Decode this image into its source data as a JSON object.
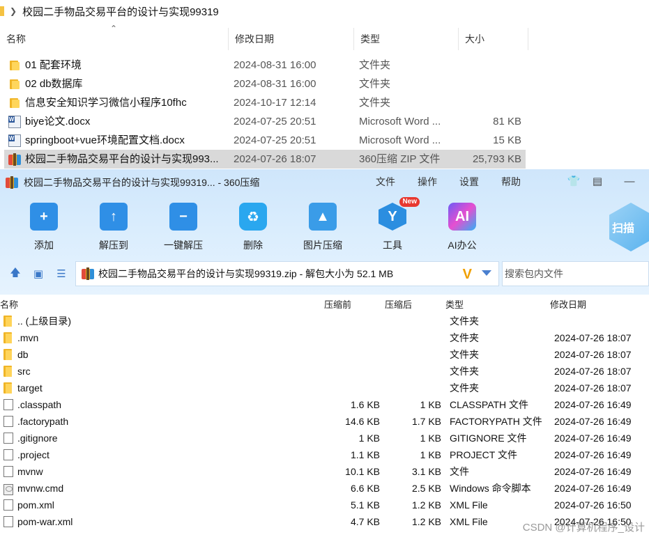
{
  "explorer": {
    "path_title": "校园二手物品交易平台的设计与实现99319",
    "columns": {
      "name": "名称",
      "modified": "修改日期",
      "type": "类型",
      "size": "大小"
    },
    "rows": [
      {
        "name": "01 配套环境",
        "date": "2024-08-31 16:00",
        "type": "文件夹",
        "size": "",
        "icon": "folder-icon"
      },
      {
        "name": "02 db数据库",
        "date": "2024-08-31 16:00",
        "type": "文件夹",
        "size": "",
        "icon": "folder-icon"
      },
      {
        "name": "信息安全知识学习微信小程序10fhc",
        "date": "2024-10-17 12:14",
        "type": "文件夹",
        "size": "",
        "icon": "folder-icon"
      },
      {
        "name": "biye论文.docx",
        "date": "2024-07-25 20:51",
        "type": "Microsoft Word ...",
        "size": "81 KB",
        "icon": "word-doc-icon"
      },
      {
        "name": "springboot+vue环境配置文档.docx",
        "date": "2024-07-25 20:51",
        "type": "Microsoft Word ...",
        "size": "15 KB",
        "icon": "word-doc-icon"
      },
      {
        "name": "校园二手物品交易平台的设计与实现993...",
        "date": "2024-07-26 18:07",
        "type": "360压缩 ZIP 文件",
        "size": "25,793 KB",
        "icon": "zip-archive-icon"
      }
    ]
  },
  "zip": {
    "title": "校园二手物品交易平台的设计与实现99319... - 360压缩",
    "menu": [
      "文件",
      "操作",
      "设置",
      "帮助"
    ],
    "toolbar": [
      {
        "label": "添加",
        "icon": "add-icon"
      },
      {
        "label": "解压到",
        "icon": "extract-to-icon"
      },
      {
        "label": "一键解压",
        "icon": "one-click-extract-icon"
      },
      {
        "label": "删除",
        "icon": "delete-icon"
      },
      {
        "label": "图片压缩",
        "icon": "image-compress-icon"
      },
      {
        "label": "工具",
        "icon": "tools-icon",
        "badge": "New"
      },
      {
        "label": "AI办公",
        "icon": "ai-office-icon",
        "glyph": "AI"
      }
    ],
    "scan_label": "扫描",
    "address": "校园二手物品交易平台的设计与实现99319.zip - 解包大小为 52.1 MB",
    "search_placeholder": "搜索包内文件",
    "columns": {
      "name": "名称",
      "packed_before": "压缩前",
      "packed_after": "压缩后",
      "type": "类型",
      "date": "修改日期"
    },
    "rows": [
      {
        "name": ".. (上级目录)",
        "before": "",
        "after": "",
        "type": "文件夹",
        "date": "",
        "kind": "folder"
      },
      {
        "name": ".mvn",
        "before": "",
        "after": "",
        "type": "文件夹",
        "date": "2024-07-26 18:07",
        "kind": "folder"
      },
      {
        "name": "db",
        "before": "",
        "after": "",
        "type": "文件夹",
        "date": "2024-07-26 18:07",
        "kind": "folder"
      },
      {
        "name": "src",
        "before": "",
        "after": "",
        "type": "文件夹",
        "date": "2024-07-26 18:07",
        "kind": "folder"
      },
      {
        "name": "target",
        "before": "",
        "after": "",
        "type": "文件夹",
        "date": "2024-07-26 18:07",
        "kind": "folder"
      },
      {
        "name": ".classpath",
        "before": "1.6 KB",
        "after": "1 KB",
        "type": "CLASSPATH 文件",
        "date": "2024-07-26 16:49",
        "kind": "file"
      },
      {
        "name": ".factorypath",
        "before": "14.6 KB",
        "after": "1.7 KB",
        "type": "FACTORYPATH 文件",
        "date": "2024-07-26 16:49",
        "kind": "file"
      },
      {
        "name": ".gitignore",
        "before": "1 KB",
        "after": "1 KB",
        "type": "GITIGNORE 文件",
        "date": "2024-07-26 16:49",
        "kind": "file"
      },
      {
        "name": ".project",
        "before": "1.1 KB",
        "after": "1 KB",
        "type": "PROJECT 文件",
        "date": "2024-07-26 16:49",
        "kind": "file"
      },
      {
        "name": "mvnw",
        "before": "10.1 KB",
        "after": "3.1 KB",
        "type": "文件",
        "date": "2024-07-26 16:49",
        "kind": "file"
      },
      {
        "name": "mvnw.cmd",
        "before": "6.6 KB",
        "after": "2.5 KB",
        "type": "Windows 命令脚本",
        "date": "2024-07-26 16:49",
        "kind": "cmd"
      },
      {
        "name": "pom.xml",
        "before": "5.1 KB",
        "after": "1.2 KB",
        "type": "XML File",
        "date": "2024-07-26 16:50",
        "kind": "file"
      },
      {
        "name": "pom-war.xml",
        "before": "4.7 KB",
        "after": "1.2 KB",
        "type": "XML File",
        "date": "2024-07-26 16:50",
        "kind": "file"
      }
    ]
  },
  "watermark": "CSDN @计算机程序_设计"
}
